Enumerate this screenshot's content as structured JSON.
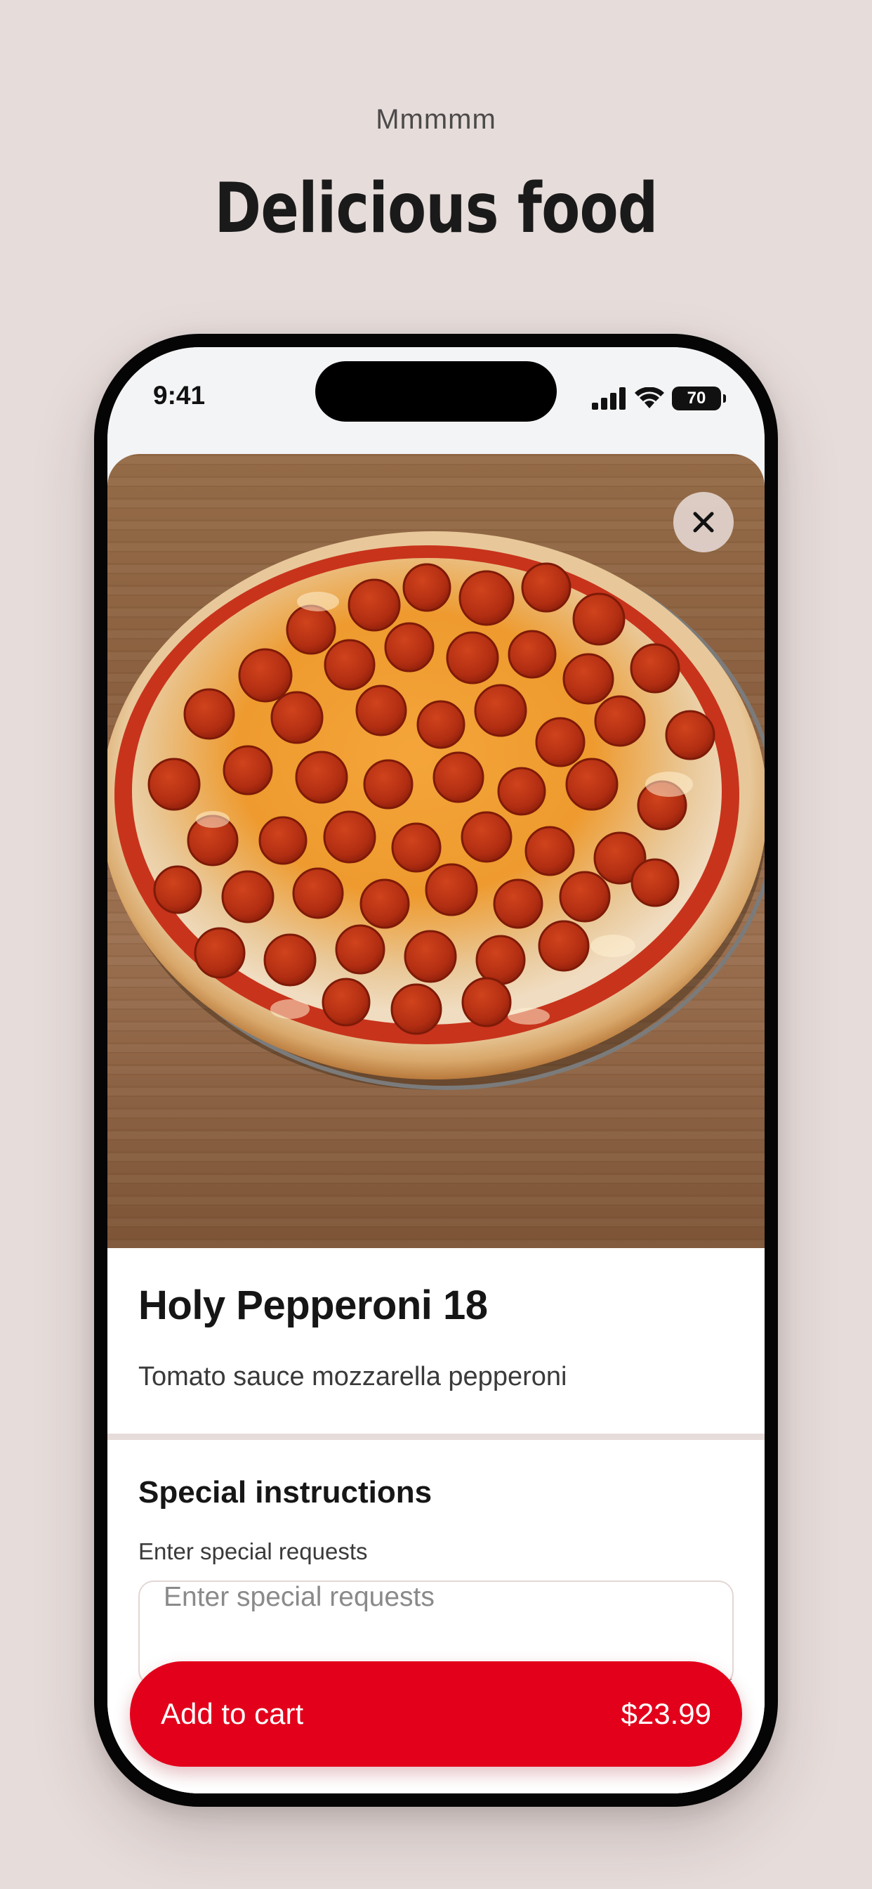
{
  "promo": {
    "eyebrow": "Mmmmm",
    "title": "Delicious food"
  },
  "status_bar": {
    "time": "9:41",
    "battery": "70",
    "icons": [
      "signal-icon",
      "wifi-icon",
      "battery-icon"
    ]
  },
  "item": {
    "image": "pepperoni-pizza-photo",
    "close_icon": "close-icon",
    "name": "Holy Pepperoni 18",
    "description": "Tomato sauce mozzarella pepperoni"
  },
  "instructions": {
    "title": "Special instructions",
    "subtitle": "Enter special requests",
    "placeholder": "Enter special requests",
    "value": ""
  },
  "cart_button": {
    "label": "Add to cart",
    "price": "$23.99"
  },
  "colors": {
    "background": "#e6dcda",
    "accent": "#e3001b",
    "text": "#1a1a1a"
  }
}
